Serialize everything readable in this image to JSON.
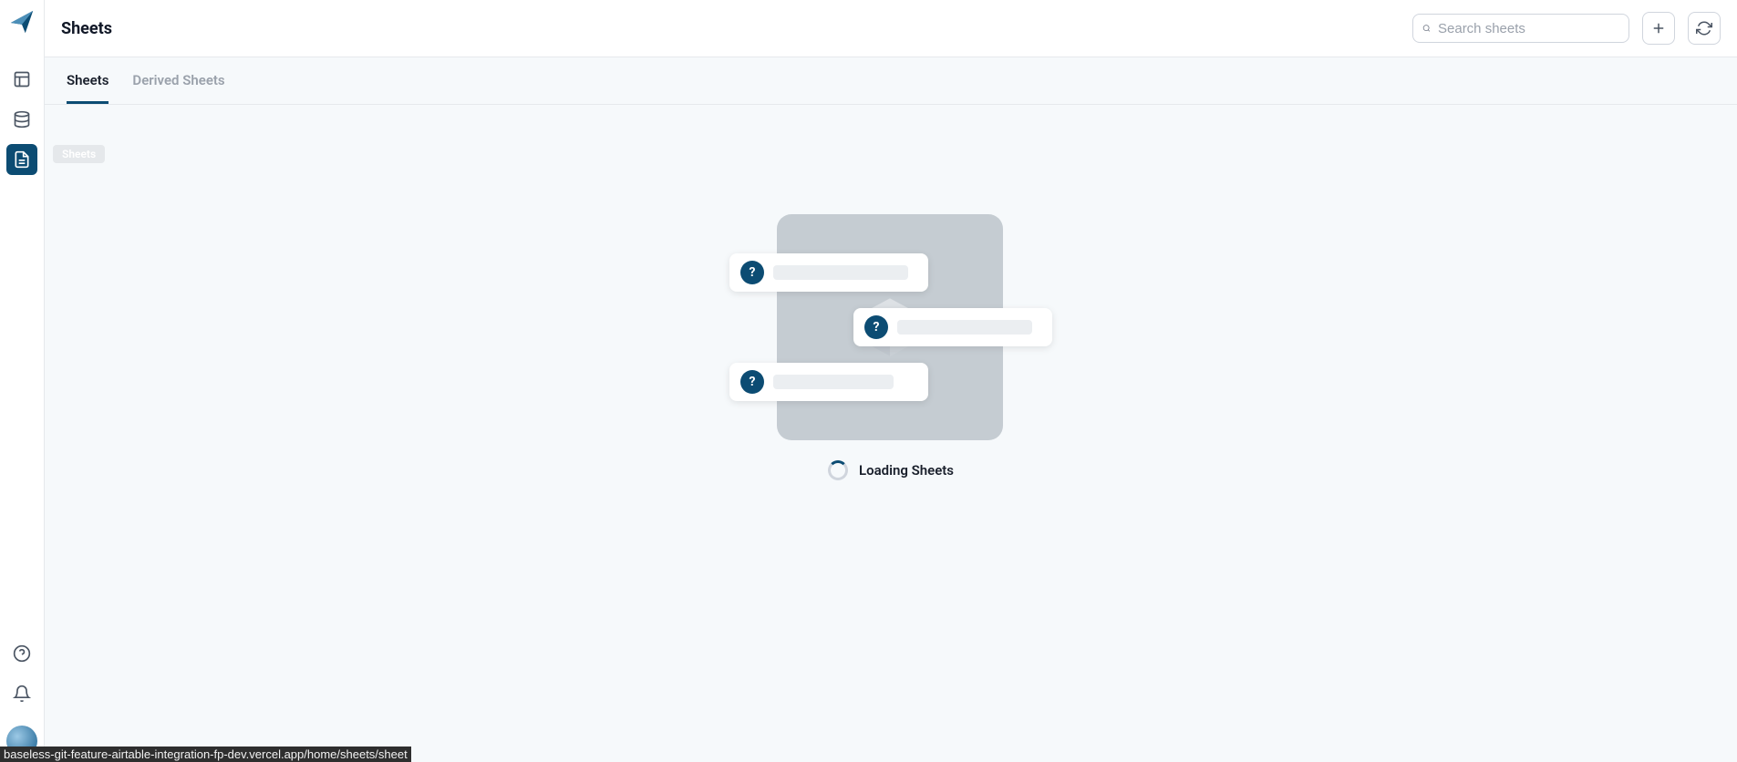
{
  "header": {
    "title": "Sheets",
    "search_placeholder": "Search sheets"
  },
  "sidebar": {
    "tooltip": "Sheets"
  },
  "tabs": [
    {
      "label": "Sheets",
      "active": true
    },
    {
      "label": "Derived Sheets",
      "active": false
    }
  ],
  "loading": {
    "text": "Loading Sheets"
  },
  "illustration": {
    "question_mark": "?"
  },
  "status_url": "baseless-git-feature-airtable-integration-fp-dev.vercel.app/home/sheets/sheet"
}
